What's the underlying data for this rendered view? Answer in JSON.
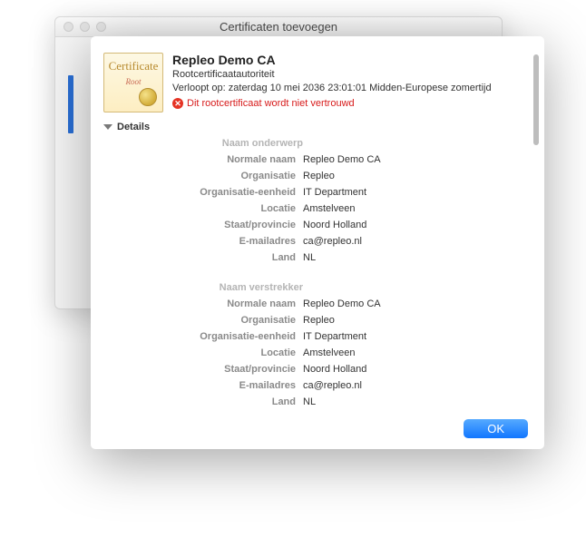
{
  "window": {
    "title": "Certificaten toevoegen"
  },
  "certificate": {
    "icon_label": "Certificate",
    "icon_root": "Root",
    "title": "Repleo Demo CA",
    "subtitle": "Rootcertificaatautoriteit",
    "expiry": "Verloopt op: zaterdag 10 mei 2036 23:01:01 Midden-Europese zomertijd",
    "trust_status": "Dit rootcertificaat wordt niet vertrouwd"
  },
  "details": {
    "label": "Details",
    "subject": {
      "heading": "Naam onderwerp",
      "rows": [
        {
          "label": "Normale naam",
          "value": "Repleo Demo CA"
        },
        {
          "label": "Organisatie",
          "value": "Repleo"
        },
        {
          "label": "Organisatie-eenheid",
          "value": "IT Department"
        },
        {
          "label": "Locatie",
          "value": "Amstelveen"
        },
        {
          "label": "Staat/provincie",
          "value": "Noord Holland"
        },
        {
          "label": "E-mailadres",
          "value": "ca@repleo.nl"
        },
        {
          "label": "Land",
          "value": "NL"
        }
      ]
    },
    "issuer": {
      "heading": "Naam verstrekker",
      "rows": [
        {
          "label": "Normale naam",
          "value": "Repleo Demo CA"
        },
        {
          "label": "Organisatie",
          "value": "Repleo"
        },
        {
          "label": "Organisatie-eenheid",
          "value": "IT Department"
        },
        {
          "label": "Locatie",
          "value": "Amstelveen"
        },
        {
          "label": "Staat/provincie",
          "value": "Noord Holland"
        },
        {
          "label": "E-mailadres",
          "value": "ca@repleo.nl"
        },
        {
          "label": "Land",
          "value": "NL"
        }
      ]
    }
  },
  "buttons": {
    "ok": "OK"
  },
  "colors": {
    "error": "#d71a1a",
    "primary": "#1176ff"
  }
}
